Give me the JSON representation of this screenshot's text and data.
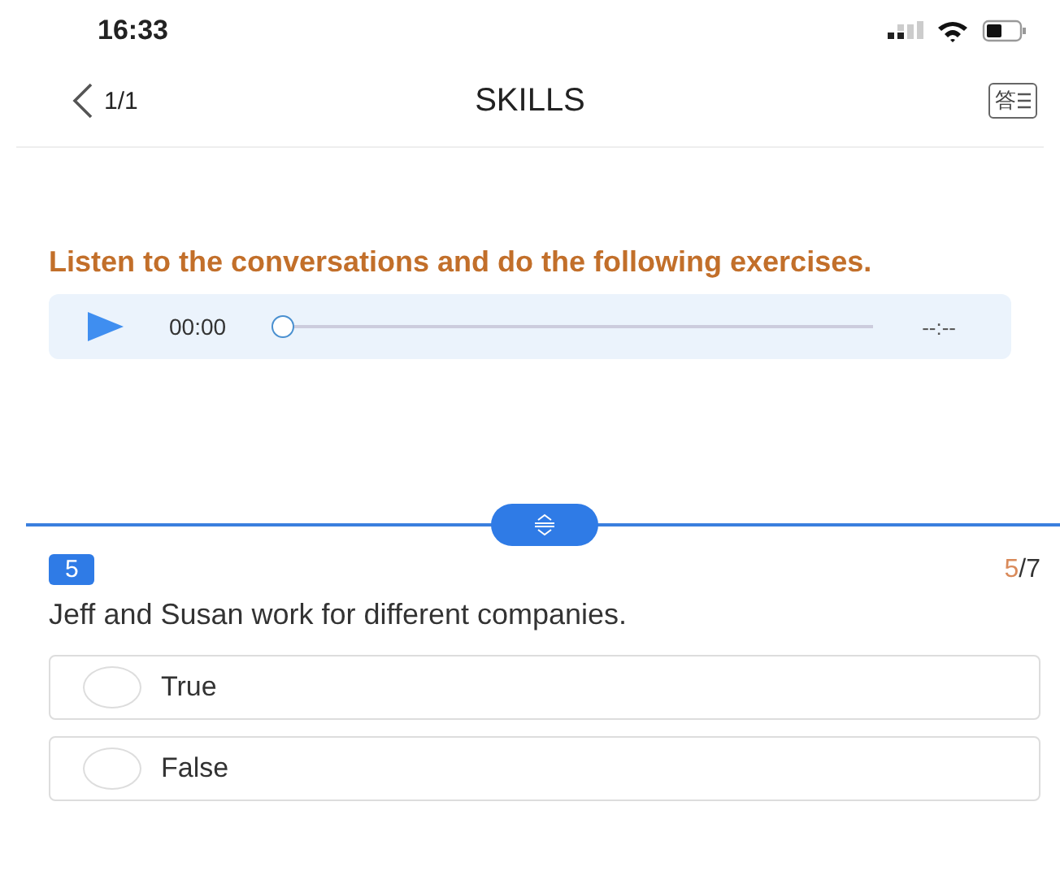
{
  "status_bar": {
    "time": "16:33"
  },
  "nav": {
    "back_label": "1/1",
    "title": "SKILLS",
    "answer_sheet_label": "答"
  },
  "instruction": "Listen to the conversations and do the following exercises.",
  "player": {
    "elapsed": "00:00",
    "duration": "--:--",
    "level": 0
  },
  "question": {
    "number": "5",
    "progress_current": "5",
    "progress_total": "/7",
    "text": "Jeff and Susan work for different companies.",
    "options": [
      {
        "label": "True",
        "selected": false
      },
      {
        "label": "False",
        "selected": false
      }
    ]
  }
}
